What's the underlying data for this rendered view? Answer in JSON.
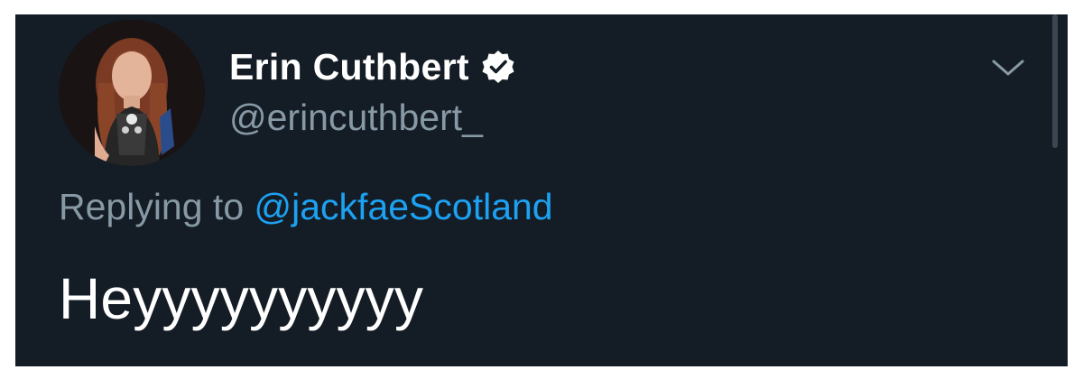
{
  "tweet": {
    "author": {
      "display_name": "Erin Cuthbert",
      "handle": "@erincuthbert_",
      "verified": true
    },
    "reply_prefix": "Replying to",
    "reply_to": "@jackfaeScotland",
    "text": "Heyyyyyyyyyy"
  },
  "icons": {
    "verified": "verified-badge-icon",
    "menu": "chevron-down-icon"
  },
  "colors": {
    "background": "#141d26",
    "name": "#ffffff",
    "secondary_text": "#8899a6",
    "link": "#1da1f2"
  }
}
